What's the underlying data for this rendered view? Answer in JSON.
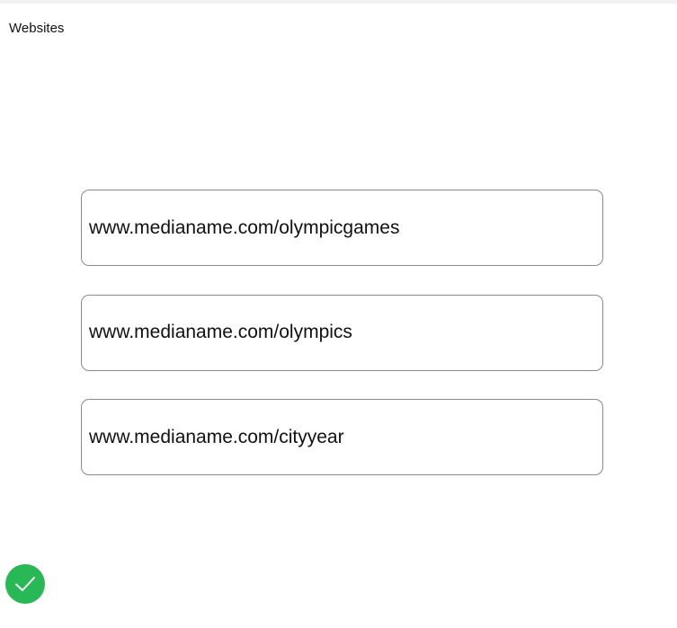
{
  "header": {
    "title": "Websites"
  },
  "websites": [
    {
      "url": "www.medianame.com/olympicgames"
    },
    {
      "url": "www.medianame.com/olympics"
    },
    {
      "url": "www.medianame.com/cityyear"
    }
  ],
  "confirm": {
    "icon": "checkmark-icon",
    "color": "#28b856"
  }
}
